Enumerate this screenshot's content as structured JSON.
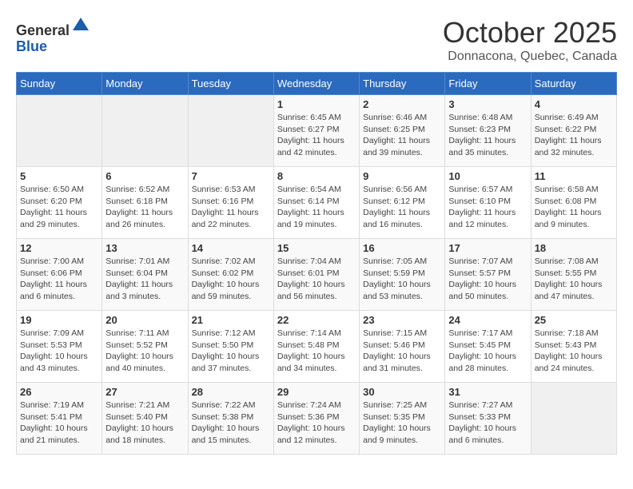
{
  "header": {
    "logo_general": "General",
    "logo_blue": "Blue",
    "month": "October 2025",
    "location": "Donnacona, Quebec, Canada"
  },
  "days_of_week": [
    "Sunday",
    "Monday",
    "Tuesday",
    "Wednesday",
    "Thursday",
    "Friday",
    "Saturday"
  ],
  "weeks": [
    [
      {
        "day": "",
        "info": ""
      },
      {
        "day": "",
        "info": ""
      },
      {
        "day": "",
        "info": ""
      },
      {
        "day": "1",
        "info": "Sunrise: 6:45 AM\nSunset: 6:27 PM\nDaylight: 11 hours\nand 42 minutes."
      },
      {
        "day": "2",
        "info": "Sunrise: 6:46 AM\nSunset: 6:25 PM\nDaylight: 11 hours\nand 39 minutes."
      },
      {
        "day": "3",
        "info": "Sunrise: 6:48 AM\nSunset: 6:23 PM\nDaylight: 11 hours\nand 35 minutes."
      },
      {
        "day": "4",
        "info": "Sunrise: 6:49 AM\nSunset: 6:22 PM\nDaylight: 11 hours\nand 32 minutes."
      }
    ],
    [
      {
        "day": "5",
        "info": "Sunrise: 6:50 AM\nSunset: 6:20 PM\nDaylight: 11 hours\nand 29 minutes."
      },
      {
        "day": "6",
        "info": "Sunrise: 6:52 AM\nSunset: 6:18 PM\nDaylight: 11 hours\nand 26 minutes."
      },
      {
        "day": "7",
        "info": "Sunrise: 6:53 AM\nSunset: 6:16 PM\nDaylight: 11 hours\nand 22 minutes."
      },
      {
        "day": "8",
        "info": "Sunrise: 6:54 AM\nSunset: 6:14 PM\nDaylight: 11 hours\nand 19 minutes."
      },
      {
        "day": "9",
        "info": "Sunrise: 6:56 AM\nSunset: 6:12 PM\nDaylight: 11 hours\nand 16 minutes."
      },
      {
        "day": "10",
        "info": "Sunrise: 6:57 AM\nSunset: 6:10 PM\nDaylight: 11 hours\nand 12 minutes."
      },
      {
        "day": "11",
        "info": "Sunrise: 6:58 AM\nSunset: 6:08 PM\nDaylight: 11 hours\nand 9 minutes."
      }
    ],
    [
      {
        "day": "12",
        "info": "Sunrise: 7:00 AM\nSunset: 6:06 PM\nDaylight: 11 hours\nand 6 minutes."
      },
      {
        "day": "13",
        "info": "Sunrise: 7:01 AM\nSunset: 6:04 PM\nDaylight: 11 hours\nand 3 minutes."
      },
      {
        "day": "14",
        "info": "Sunrise: 7:02 AM\nSunset: 6:02 PM\nDaylight: 10 hours\nand 59 minutes."
      },
      {
        "day": "15",
        "info": "Sunrise: 7:04 AM\nSunset: 6:01 PM\nDaylight: 10 hours\nand 56 minutes."
      },
      {
        "day": "16",
        "info": "Sunrise: 7:05 AM\nSunset: 5:59 PM\nDaylight: 10 hours\nand 53 minutes."
      },
      {
        "day": "17",
        "info": "Sunrise: 7:07 AM\nSunset: 5:57 PM\nDaylight: 10 hours\nand 50 minutes."
      },
      {
        "day": "18",
        "info": "Sunrise: 7:08 AM\nSunset: 5:55 PM\nDaylight: 10 hours\nand 47 minutes."
      }
    ],
    [
      {
        "day": "19",
        "info": "Sunrise: 7:09 AM\nSunset: 5:53 PM\nDaylight: 10 hours\nand 43 minutes."
      },
      {
        "day": "20",
        "info": "Sunrise: 7:11 AM\nSunset: 5:52 PM\nDaylight: 10 hours\nand 40 minutes."
      },
      {
        "day": "21",
        "info": "Sunrise: 7:12 AM\nSunset: 5:50 PM\nDaylight: 10 hours\nand 37 minutes."
      },
      {
        "day": "22",
        "info": "Sunrise: 7:14 AM\nSunset: 5:48 PM\nDaylight: 10 hours\nand 34 minutes."
      },
      {
        "day": "23",
        "info": "Sunrise: 7:15 AM\nSunset: 5:46 PM\nDaylight: 10 hours\nand 31 minutes."
      },
      {
        "day": "24",
        "info": "Sunrise: 7:17 AM\nSunset: 5:45 PM\nDaylight: 10 hours\nand 28 minutes."
      },
      {
        "day": "25",
        "info": "Sunrise: 7:18 AM\nSunset: 5:43 PM\nDaylight: 10 hours\nand 24 minutes."
      }
    ],
    [
      {
        "day": "26",
        "info": "Sunrise: 7:19 AM\nSunset: 5:41 PM\nDaylight: 10 hours\nand 21 minutes."
      },
      {
        "day": "27",
        "info": "Sunrise: 7:21 AM\nSunset: 5:40 PM\nDaylight: 10 hours\nand 18 minutes."
      },
      {
        "day": "28",
        "info": "Sunrise: 7:22 AM\nSunset: 5:38 PM\nDaylight: 10 hours\nand 15 minutes."
      },
      {
        "day": "29",
        "info": "Sunrise: 7:24 AM\nSunset: 5:36 PM\nDaylight: 10 hours\nand 12 minutes."
      },
      {
        "day": "30",
        "info": "Sunrise: 7:25 AM\nSunset: 5:35 PM\nDaylight: 10 hours\nand 9 minutes."
      },
      {
        "day": "31",
        "info": "Sunrise: 7:27 AM\nSunset: 5:33 PM\nDaylight: 10 hours\nand 6 minutes."
      },
      {
        "day": "",
        "info": ""
      }
    ]
  ]
}
